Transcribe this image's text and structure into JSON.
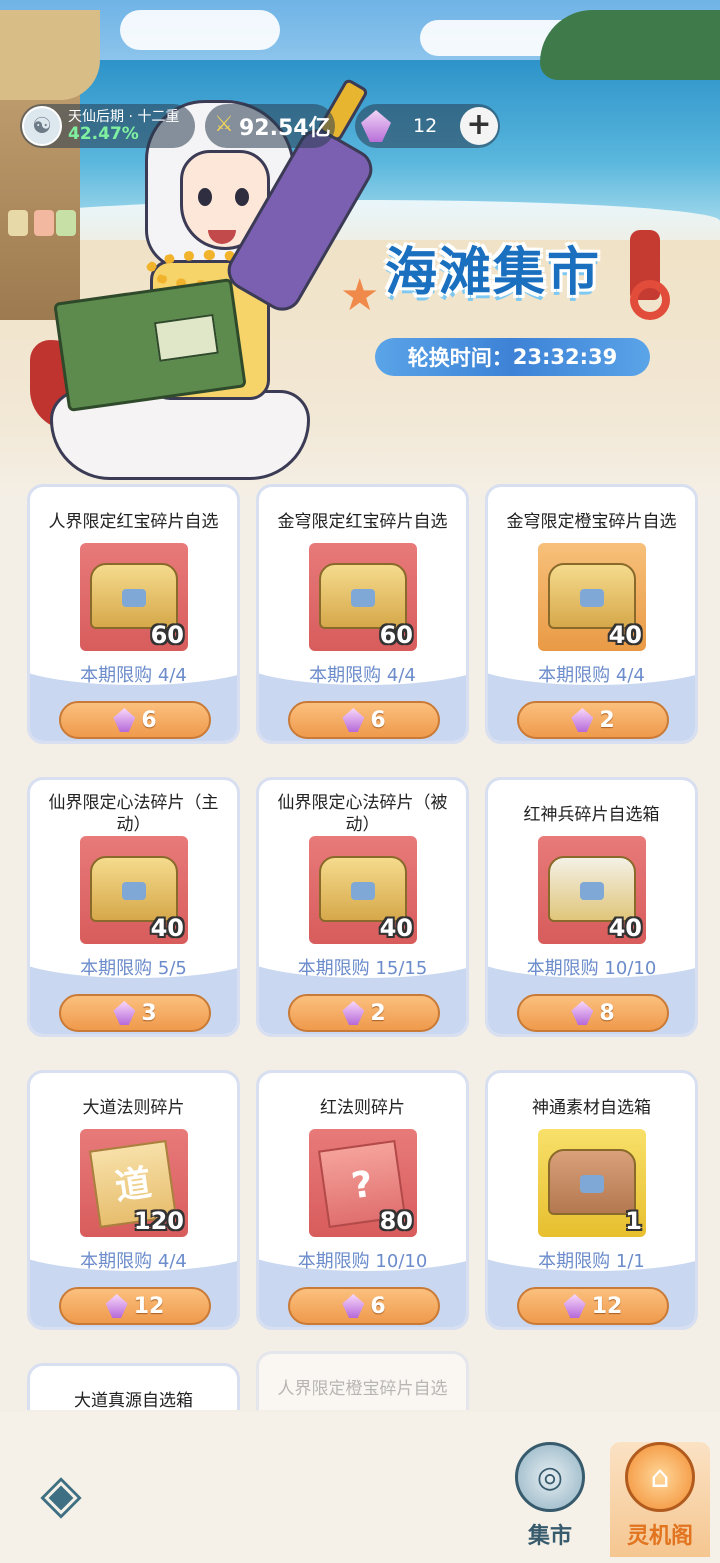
{
  "hud": {
    "rank_title": "天仙后期 · 十二重",
    "rank_progress": "42.47%",
    "power": "92.54亿",
    "gem_count": "12",
    "plus_label": "+"
  },
  "shop": {
    "title": "海滩集市",
    "timer_label": "轮换时间：",
    "timer_value": "23:32:39"
  },
  "items": [
    {
      "name": "人界限定红宝碎片自选",
      "qty": "60",
      "limit": "本期限购 4/4",
      "price": "6"
    },
    {
      "name": "金穹限定红宝碎片自选",
      "qty": "60",
      "limit": "本期限购 4/4",
      "price": "6"
    },
    {
      "name": "金穹限定橙宝碎片自选",
      "qty": "40",
      "limit": "本期限购 4/4",
      "price": "2"
    },
    {
      "name": "仙界限定心法碎片（主动）",
      "qty": "40",
      "limit": "本期限购 5/5",
      "price": "3"
    },
    {
      "name": "仙界限定心法碎片（被动）",
      "qty": "40",
      "limit": "本期限购 15/15",
      "price": "2"
    },
    {
      "name": "红神兵碎片自选箱",
      "qty": "40",
      "limit": "本期限购 10/10",
      "price": "8"
    },
    {
      "name": "大道法则碎片",
      "qty": "120",
      "limit": "本期限购 4/4",
      "price": "12"
    },
    {
      "name": "红法则碎片",
      "qty": "80",
      "limit": "本期限购 10/10",
      "price": "6"
    },
    {
      "name": "神通素材自选箱",
      "qty": "1",
      "limit": "本期限购 1/1",
      "price": "12"
    },
    {
      "name": "大道真源自选箱",
      "qty": "",
      "limit": "",
      "price": ""
    },
    {
      "name": "人界限定橙宝碎片自选",
      "qty": "",
      "limit": "",
      "price": ""
    }
  ],
  "scroll_glyph": "道",
  "scroll_glyph_2": "?",
  "nav": {
    "tab_market": "集市",
    "tab_lingjige": "灵机阁"
  },
  "colors": {
    "accent_orange": "#ef9a4c",
    "title_blue": "#1a6fbf",
    "limit_blue": "#6c8ccb"
  }
}
